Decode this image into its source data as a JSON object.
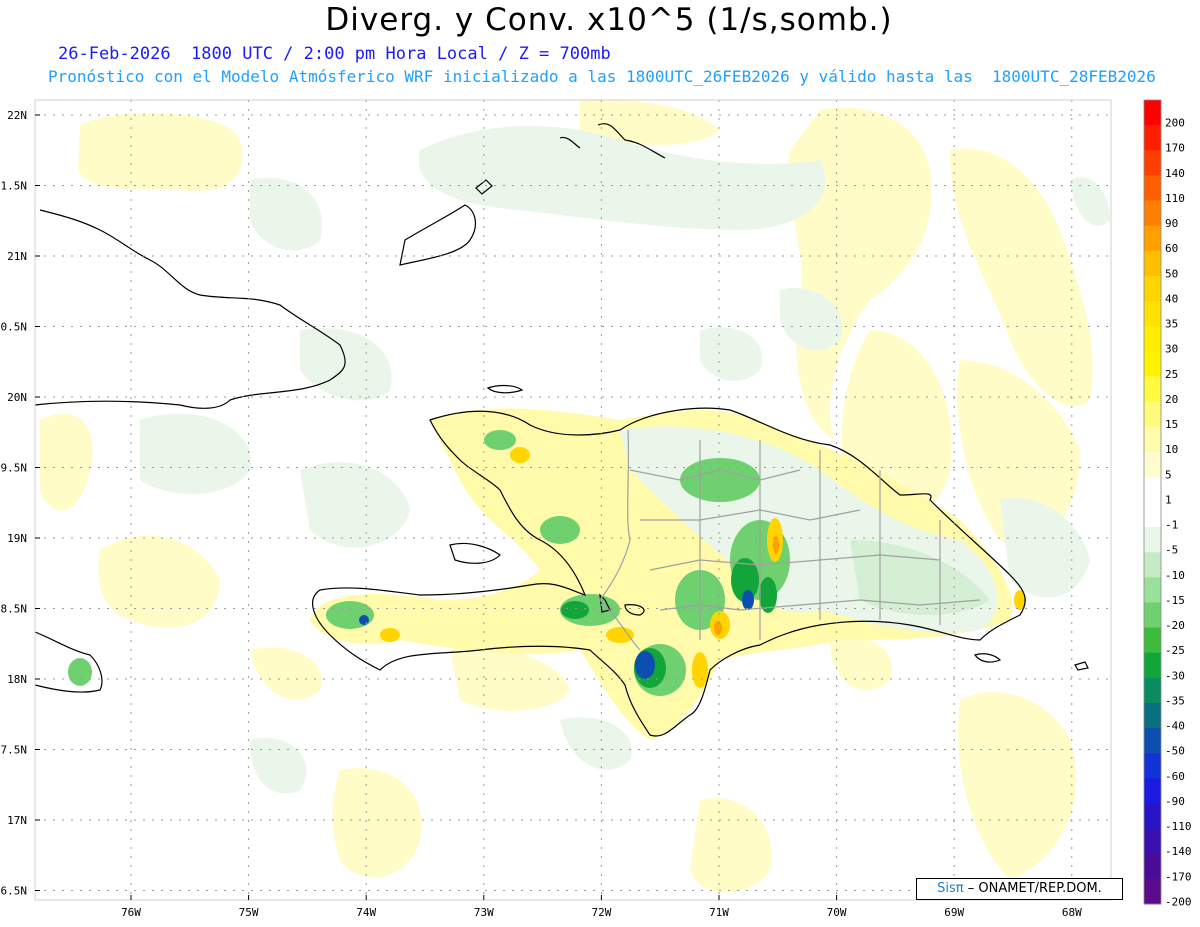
{
  "header": {
    "title": "Diverg. y Conv. x10^5 (1/s,somb.)",
    "line1": "26-Feb-2026  1800 UTC / 2:00 pm Hora Local / Z = 700mb",
    "line2": "Pronóstico con el Modelo Atmósferico WRF inicializado a las 1800UTC_26FEB2026 y válido hasta las  1800UTC_28FEB2026"
  },
  "map": {
    "lat_labels": [
      "22N",
      "1.5N",
      "21N",
      "0.5N",
      "20N",
      "9.5N",
      "19N",
      "8.5N",
      "18N",
      "7.5N",
      "17N",
      "6.5N"
    ],
    "lon_labels": [
      "76W",
      "75W",
      "74W",
      "73W",
      "72W",
      "71W",
      "70W",
      "69W",
      "68W"
    ]
  },
  "colorbar": {
    "labels": [
      "200",
      "170",
      "140",
      "110",
      "90",
      "60",
      "50",
      "40",
      "35",
      "30",
      "25",
      "20",
      "15",
      "10",
      "5",
      "1",
      "-1",
      "-5",
      "-10",
      "-15",
      "-20",
      "-25",
      "-30",
      "-35",
      "-40",
      "-50",
      "-60",
      "-90",
      "-110",
      "-140",
      "-170",
      "-200"
    ],
    "colors": [
      "#ff0000",
      "#ff1f00",
      "#ff3f00",
      "#ff5f00",
      "#ff7f00",
      "#ff9f00",
      "#ffbf00",
      "#ffd400",
      "#ffe100",
      "#ffee00",
      "#fff400",
      "#fffa40",
      "#fffa7a",
      "#fffbaa",
      "#fffcd0",
      "#ffffff",
      "#ffffff",
      "#eaf6ea",
      "#c4ebc4",
      "#9adf9a",
      "#6fd06f",
      "#3dbb3d",
      "#12a63a",
      "#0a8c5e",
      "#0a6f7e",
      "#0c4fb0",
      "#1232d8",
      "#1a1ae0",
      "#2a14c8",
      "#3a10b0",
      "#4a0c98",
      "#5a0a8a"
    ]
  },
  "credit": {
    "logo": "Sisπ",
    "text": "– ONAMET/REP.DOM."
  }
}
